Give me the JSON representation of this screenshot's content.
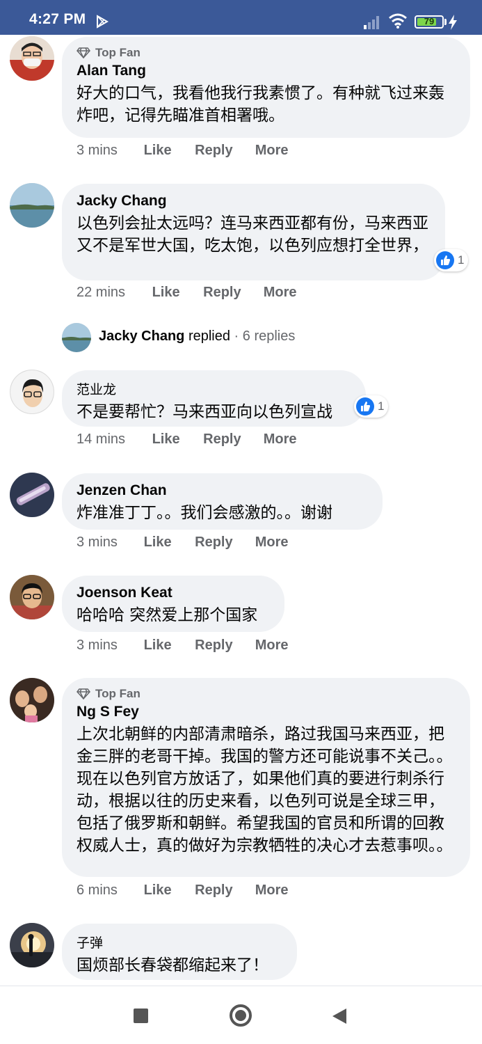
{
  "status_bar": {
    "time": "4:27 PM",
    "battery": "79",
    "battery_level": 0.79
  },
  "comments": [
    {
      "badge": "Top Fan",
      "author": "Alan Tang",
      "text": "好大的口气，我看他我行我素惯了。有种就飞过来轰炸吧，记得先瞄准首相署哦。",
      "time": "3 mins",
      "like": "Like",
      "reply": "Reply",
      "more": "More"
    },
    {
      "author": "Jacky Chang",
      "text": "以色列会扯太远吗？连马来西亚都有份，马来西亚又不是军世大国，吃太饱，以色列应想打全世界，",
      "reactions": "1",
      "time": "22 mins",
      "like": "Like",
      "reply": "Reply",
      "more": "More"
    },
    {
      "author": "范业龙",
      "text": "不是要帮忙？马来西亚向以色列宣战",
      "reactions": "1",
      "time": "14 mins",
      "like": "Like",
      "reply": "Reply",
      "more": "More"
    },
    {
      "author": "Jenzen Chan",
      "text": "炸准准丁丁。。我们会感激的。。谢谢",
      "time": "3 mins",
      "like": "Like",
      "reply": "Reply",
      "more": "More"
    },
    {
      "author": "Joenson Keat",
      "text": "哈哈哈 突然爱上那个国家",
      "time": "3 mins",
      "like": "Like",
      "reply": "Reply",
      "more": "More"
    },
    {
      "badge": "Top Fan",
      "author": "Ng S Fey",
      "text": "上次北朝鲜的内部清肃暗杀，路过我国马来西亚，把金三胖的老哥干掉。我国的警方还可能说事不关己。。现在以色列官方放话了，如果他们真的要进行刺杀行动，根据以往的历史来看，以色列可说是全球三甲，包括了俄罗斯和朝鲜。希望我国的官员和所谓的回教权威人士，真的做好为宗教牺牲的决心才去惹事呗。。",
      "time": "6 mins",
      "like": "Like",
      "reply": "Reply",
      "more": "More"
    },
    {
      "author": "子弹",
      "text": "国烦部长春袋都缩起来了！"
    }
  ],
  "replied_row": {
    "name": "Jacky Chang",
    "action": "replied",
    "separator": " · ",
    "count": "6 replies"
  }
}
